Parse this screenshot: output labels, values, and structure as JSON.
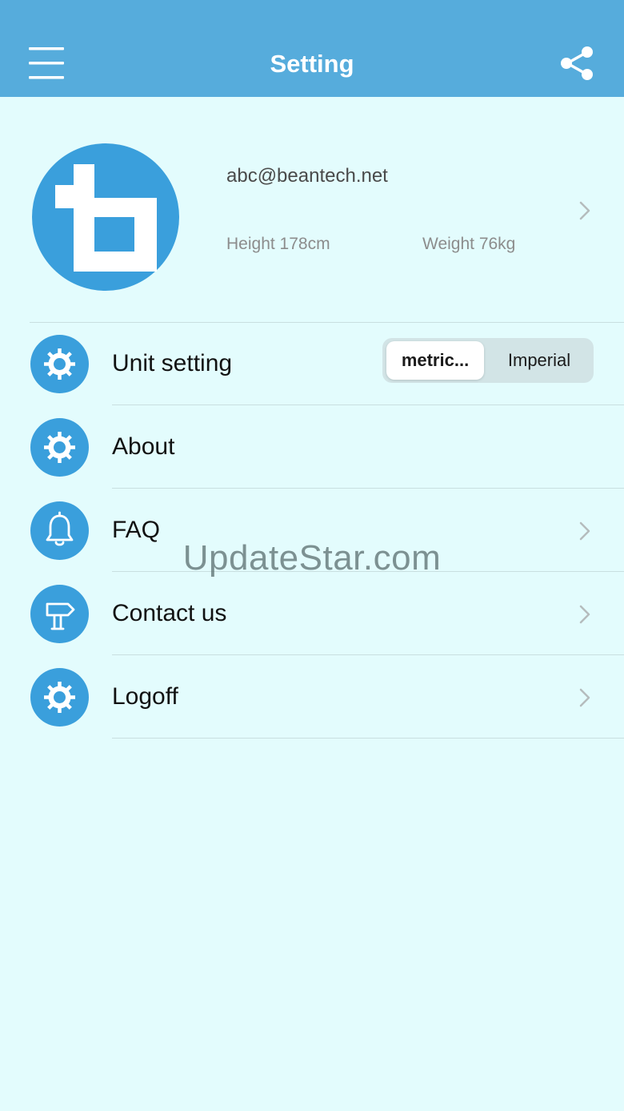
{
  "header": {
    "title": "Setting",
    "menu_icon": "hamburger-menu-icon",
    "share_icon": "share-icon"
  },
  "profile": {
    "email": "abc@beantech.net",
    "height": "Height 178cm",
    "weight": "Weight 76kg",
    "avatar_icon": "beantech-logo"
  },
  "settings": {
    "unit": {
      "label": "Unit setting",
      "icon": "gear-icon",
      "options": [
        "metric...",
        "Imperial"
      ],
      "selected": "metric..."
    },
    "about": {
      "label": "About",
      "icon": "gear-icon"
    },
    "faq": {
      "label": "FAQ",
      "icon": "bell-icon"
    },
    "contact": {
      "label": "Contact us",
      "icon": "signpost-icon"
    },
    "logoff": {
      "label": "Logoff",
      "icon": "gear-icon"
    }
  },
  "watermark": "UpdateStar.com",
  "colors": {
    "navbar": "#56acdc",
    "background": "#e3fcfd",
    "icon_circle": "#3a9fdc"
  }
}
